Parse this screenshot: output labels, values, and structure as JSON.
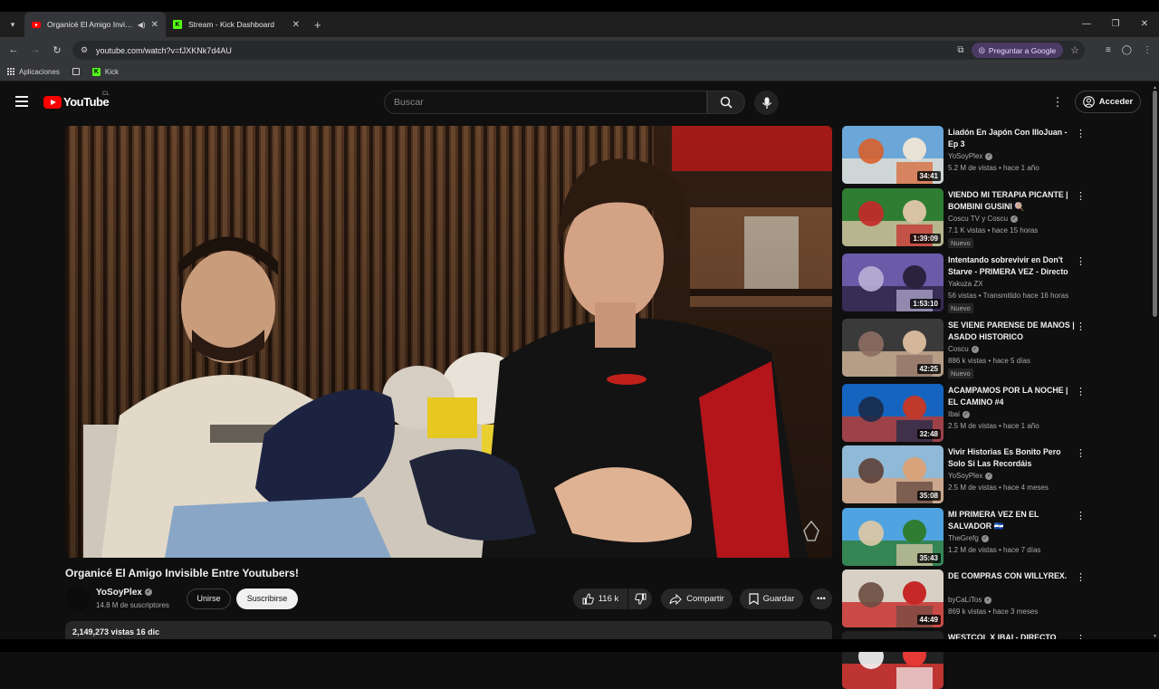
{
  "browser": {
    "tabs": [
      {
        "label": "Organicé El Amigo Invisible Entre Youtubers!",
        "active": true,
        "favicon": "youtube-icon"
      },
      {
        "label": "Stream - Kick Dashboard",
        "active": false,
        "favicon": "kick-icon"
      }
    ],
    "url": "youtube.com/watch?v=fJXKNk7d4AU",
    "ask_google": "Preguntar a Google",
    "bookmarks": [
      {
        "label": "Aplicaciones",
        "icon": "apps-grid-icon"
      },
      {
        "label": "Kick",
        "icon": "kick-icon"
      }
    ]
  },
  "youtube": {
    "logo": "YouTube",
    "country": "CL",
    "search_placeholder": "Buscar",
    "signin": "Acceder"
  },
  "video": {
    "title": "Organicé El Amigo Invisible Entre Youtubers!",
    "channel": "YoSoyPlex",
    "subscribers": "14.8 M de suscriptores",
    "join": "Unirse",
    "subscribe": "Suscribirse",
    "likes": "116 k",
    "share": "Compartir",
    "save": "Guardar",
    "views_line": "2,149,273 vistas  16 dic"
  },
  "recommendations": [
    {
      "title": "Liadón En Japón Con IlloJuan - Ep 3",
      "channel": "YoSoyPlex",
      "verified": true,
      "meta": "5.2 M de vistas • hace 1 año",
      "duration": "34:41",
      "new": "",
      "colors": [
        "#6aa6d8",
        "#e9e2d6",
        "#d8602c"
      ]
    },
    {
      "title": "VIENDO MI TERAPIA PICANTE | BOMBINI GUSINI 🍭",
      "channel": "Coscu TV y Coscu",
      "verified": true,
      "meta": "7.1 K vistas • hace 15 horas",
      "duration": "1:39:09",
      "new": "Nuevo",
      "colors": [
        "#2e7d32",
        "#d9c3a5",
        "#c62828"
      ]
    },
    {
      "title": "Intentando sobrevivir en Don't Starve - PRIMERA VEZ - Directo",
      "channel": "Yakuza ZX",
      "verified": false,
      "meta": "56 vistas • Transmitido hace 16 horas",
      "duration": "1:53:10",
      "new": "Nuevo",
      "colors": [
        "#6b5aa8",
        "#2b2240",
        "#b9b0d6"
      ]
    },
    {
      "title": "SE VIENE PARENSE DE MANOS | ASADO HISTORICO",
      "channel": "Coscu",
      "verified": true,
      "meta": "886 k vistas • hace 5 días",
      "duration": "42:25",
      "new": "Nuevo",
      "colors": [
        "#3a3a3a",
        "#d4b69a",
        "#8d6e63"
      ]
    },
    {
      "title": "ACAMPAMOS POR LA NOCHE | EL CAMINO #4",
      "channel": "Ibai",
      "verified": true,
      "meta": "2.5 M de vistas • hace 1 año",
      "duration": "32:48",
      "new": "",
      "colors": [
        "#1565c0",
        "#c0392b",
        "#1a2a4a"
      ]
    },
    {
      "title": "Vivir Historias Es Bonito Pero Solo Si Las Recordáis",
      "channel": "YoSoyPlex",
      "verified": true,
      "meta": "2.5 M de vistas • hace 4 meses",
      "duration": "35:08",
      "new": "",
      "colors": [
        "#8fb9d6",
        "#d8a27a",
        "#5d4037"
      ]
    },
    {
      "title": "MI PRIMERA VEZ EN EL SALVADOR 🇸🇻",
      "channel": "TheGrefg",
      "verified": true,
      "meta": "1.2 M de vistas • hace 7 días",
      "duration": "35:43",
      "new": "",
      "colors": [
        "#4fa3e0",
        "#2e7d32",
        "#e0c9a6"
      ]
    },
    {
      "title": "DE COMPRAS CON WILLYREX.",
      "channel": "byCaLiTos",
      "verified": true,
      "meta": "869 k vistas • hace 3 meses",
      "duration": "44:49",
      "new": "",
      "colors": [
        "#d8d0c4",
        "#c62828",
        "#6d4c41"
      ]
    },
    {
      "title": "WESTCOL X IBAI - DIRECTO",
      "channel": "",
      "verified": false,
      "meta": "",
      "duration": "",
      "new": "",
      "colors": [
        "#222222",
        "#e53935",
        "#f5f5f5"
      ]
    }
  ]
}
